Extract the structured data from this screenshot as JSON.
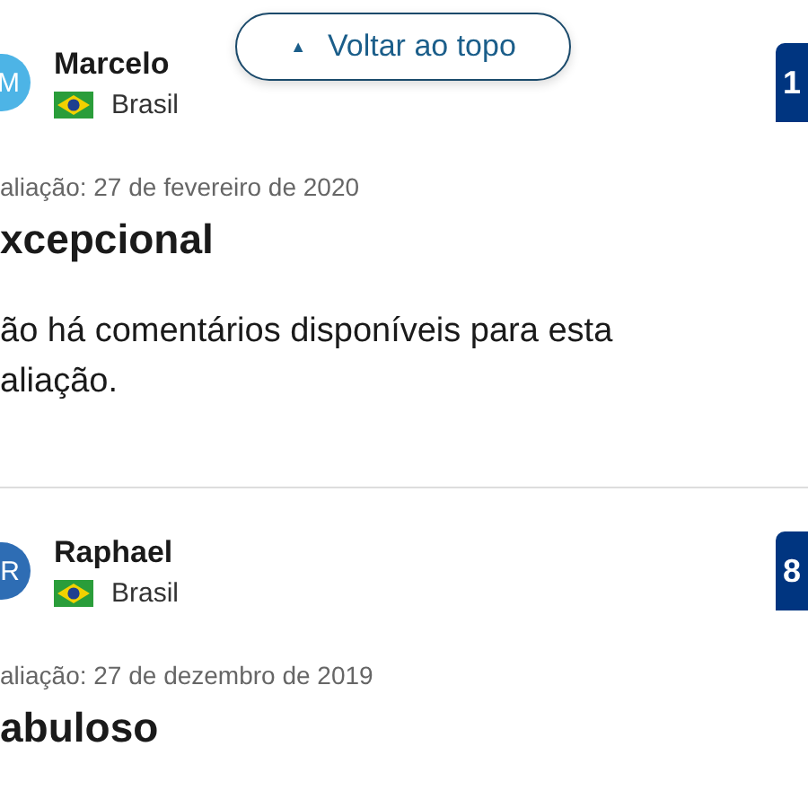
{
  "back_to_top": {
    "icon": "▲",
    "label": "Voltar ao topo"
  },
  "reviews": [
    {
      "avatar": "M",
      "color": "#4db4e6",
      "name": "Marcelo",
      "country": "Brasil",
      "score": "1",
      "date": "aliação: 27 de fevereiro de 2020",
      "title": "xcepcional",
      "text": "ão há comentários disponíveis para esta aliação."
    },
    {
      "avatar": "R",
      "color": "#2e6db4",
      "name": "Raphael",
      "country": "Brasil",
      "score": "8",
      "date": "aliação: 27 de dezembro de 2019",
      "title": "abuloso"
    }
  ]
}
